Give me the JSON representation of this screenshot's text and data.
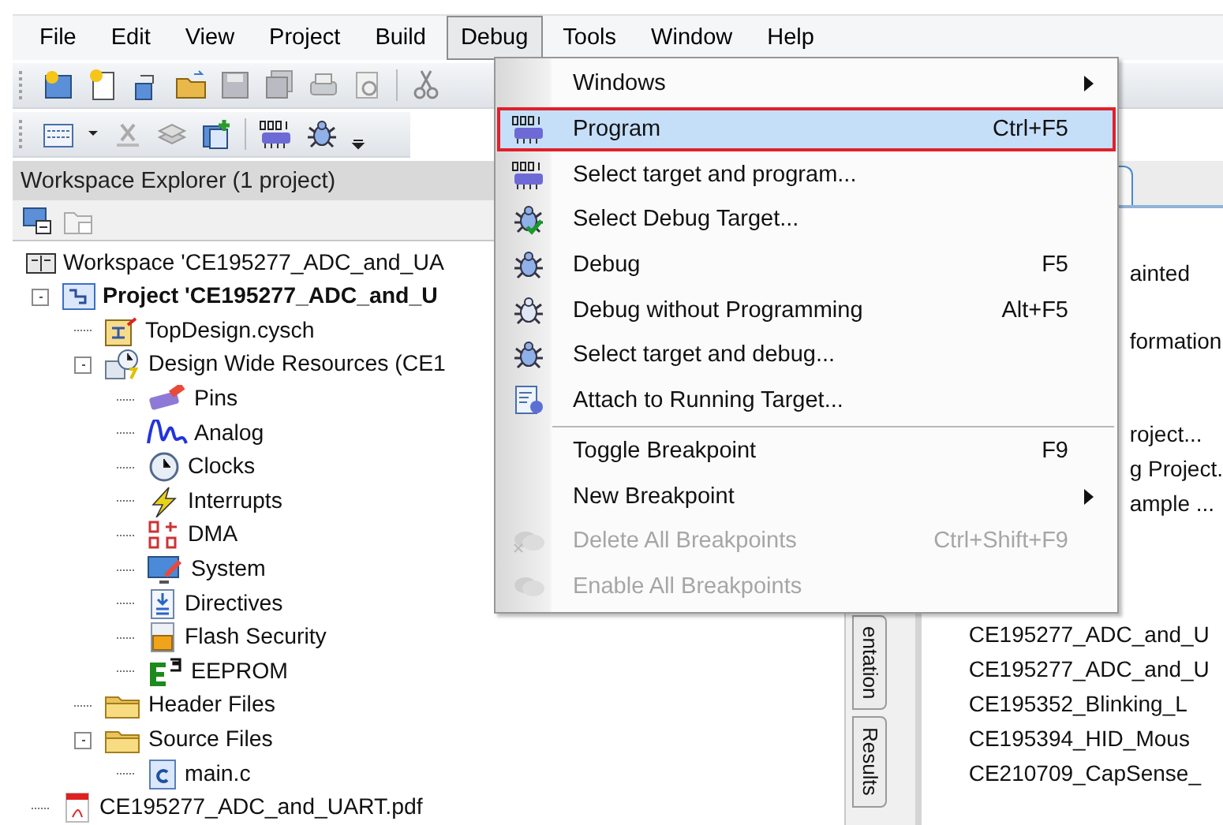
{
  "menubar": [
    {
      "label": "File",
      "selected": false
    },
    {
      "label": "Edit",
      "selected": false
    },
    {
      "label": "View",
      "selected": false
    },
    {
      "label": "Project",
      "selected": false
    },
    {
      "label": "Build",
      "selected": false
    },
    {
      "label": "Debug",
      "selected": true
    },
    {
      "label": "Tools",
      "selected": false
    },
    {
      "label": "Window",
      "selected": false
    },
    {
      "label": "Help",
      "selected": false
    }
  ],
  "workspace_explorer": {
    "title": "Workspace Explorer (1 project)",
    "tree": [
      {
        "kind": "workspace",
        "label": "Workspace 'CE195277_ADC_and_UA",
        "children": [
          {
            "kind": "project",
            "label": "Project  'CE195277_ADC_and_U",
            "expanded": true,
            "children": [
              {
                "kind": "schematic",
                "label": "TopDesign.cysch"
              },
              {
                "kind": "resources",
                "label": "Design Wide Resources (CE1",
                "expanded": true,
                "children": [
                  {
                    "kind": "pins",
                    "label": "Pins"
                  },
                  {
                    "kind": "analog",
                    "label": "Analog"
                  },
                  {
                    "kind": "clocks",
                    "label": "Clocks"
                  },
                  {
                    "kind": "interrupts",
                    "label": "Interrupts"
                  },
                  {
                    "kind": "dma",
                    "label": "DMA"
                  },
                  {
                    "kind": "system",
                    "label": "System"
                  },
                  {
                    "kind": "directives",
                    "label": "Directives"
                  },
                  {
                    "kind": "flash",
                    "label": "Flash Security"
                  },
                  {
                    "kind": "eeprom",
                    "label": "EEPROM"
                  }
                ]
              },
              {
                "kind": "folder",
                "label": "Header Files"
              },
              {
                "kind": "folder",
                "label": "Source Files",
                "expanded": true,
                "children": [
                  {
                    "kind": "cfile",
                    "label": "main.c"
                  }
                ]
              }
            ]
          },
          {
            "kind": "pdf",
            "label": "CE195277_ADC_and_UART.pdf"
          }
        ]
      }
    ]
  },
  "side_tabs": [
    {
      "label": "entation",
      "selected": false
    },
    {
      "label": "Results",
      "selected": false
    }
  ],
  "start_page": {
    "sections": [
      [
        "ainted"
      ],
      [
        "formation"
      ],
      [
        "roject...",
        "g Project.",
        "ample ..."
      ]
    ],
    "recent_projects": [
      "CE195277_ADC_and_U",
      "CE195277_ADC_and_U",
      "CE195352_Blinking_L",
      "CE195394_HID_Mous",
      "CE210709_CapSense_"
    ]
  },
  "debug_menu": [
    {
      "label": "Windows",
      "submenu": true,
      "selected": false,
      "disabled": false
    },
    {
      "label": "Program",
      "shortcut": "Ctrl+F5",
      "submenu": false,
      "selected": true,
      "disabled": false
    },
    {
      "label": "Select target and program...",
      "submenu": false,
      "selected": false,
      "disabled": false
    },
    {
      "label": "Select Debug Target...",
      "submenu": false,
      "selected": false,
      "disabled": false
    },
    {
      "label": "Debug",
      "shortcut": "F5",
      "submenu": false,
      "selected": false,
      "disabled": false
    },
    {
      "label": "Debug without Programming",
      "shortcut": "Alt+F5",
      "submenu": false,
      "selected": false,
      "disabled": false
    },
    {
      "label": "Select target and debug...",
      "submenu": false,
      "selected": false,
      "disabled": false
    },
    {
      "kind": "item",
      "label": "Attach to Running Target...",
      "submenu": false,
      "selected": false,
      "disabled": false
    },
    {
      "kind": "separator"
    },
    {
      "label": "Toggle Breakpoint",
      "shortcut": "F9",
      "submenu": false,
      "selected": false,
      "disabled": false
    },
    {
      "label": "New Breakpoint",
      "submenu": true,
      "selected": false,
      "disabled": false
    },
    {
      "label": "Delete All Breakpoints",
      "shortcut": "Ctrl+Shift+F9",
      "submenu": false,
      "selected": false,
      "disabled": true
    },
    {
      "label": "Enable All Breakpoints",
      "submenu": false,
      "selected": false,
      "disabled": true
    }
  ]
}
